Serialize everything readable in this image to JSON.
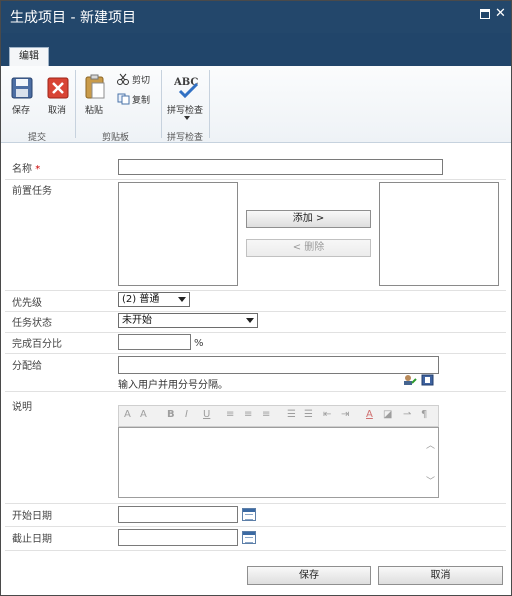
{
  "window": {
    "title": "生成项目 - 新建项目"
  },
  "ribbon": {
    "tab": "编辑",
    "save": "保存",
    "cancel": "取消",
    "paste": "粘贴",
    "cut": "剪切",
    "copy": "复制",
    "spellcheck": "拼写检查",
    "groups": {
      "commit": "提交",
      "clipboard": "剪贴板",
      "spelling": "拼写检查"
    }
  },
  "form": {
    "name_label": "名称",
    "required_mark": "*",
    "name_value": "",
    "predecessors_label": "前置任务",
    "add_button": "添加 >",
    "remove_button": "< 删除",
    "priority_label": "优先级",
    "priority_value": "(2) 普通",
    "status_label": "任务状态",
    "status_value": "未开始",
    "percent_label": "完成百分比",
    "percent_suffix": "%",
    "assigned_label": "分配给",
    "assigned_hint": "输入用户并用分号分隔。",
    "description_label": "说明",
    "start_label": "开始日期",
    "due_label": "截止日期"
  },
  "footer": {
    "save": "保存",
    "cancel": "取消"
  },
  "icons": {
    "save": "floppy-disk-icon",
    "cancel": "red-x-icon",
    "paste": "clipboard-icon",
    "cut": "scissors-icon",
    "copy": "copy-icon",
    "spellcheck": "abc-check-icon",
    "people": "people-picker-icon",
    "book": "address-book-icon",
    "calendar": "calendar-icon"
  },
  "colors": {
    "title_bar": "#23476b",
    "required": "#cc0000"
  }
}
